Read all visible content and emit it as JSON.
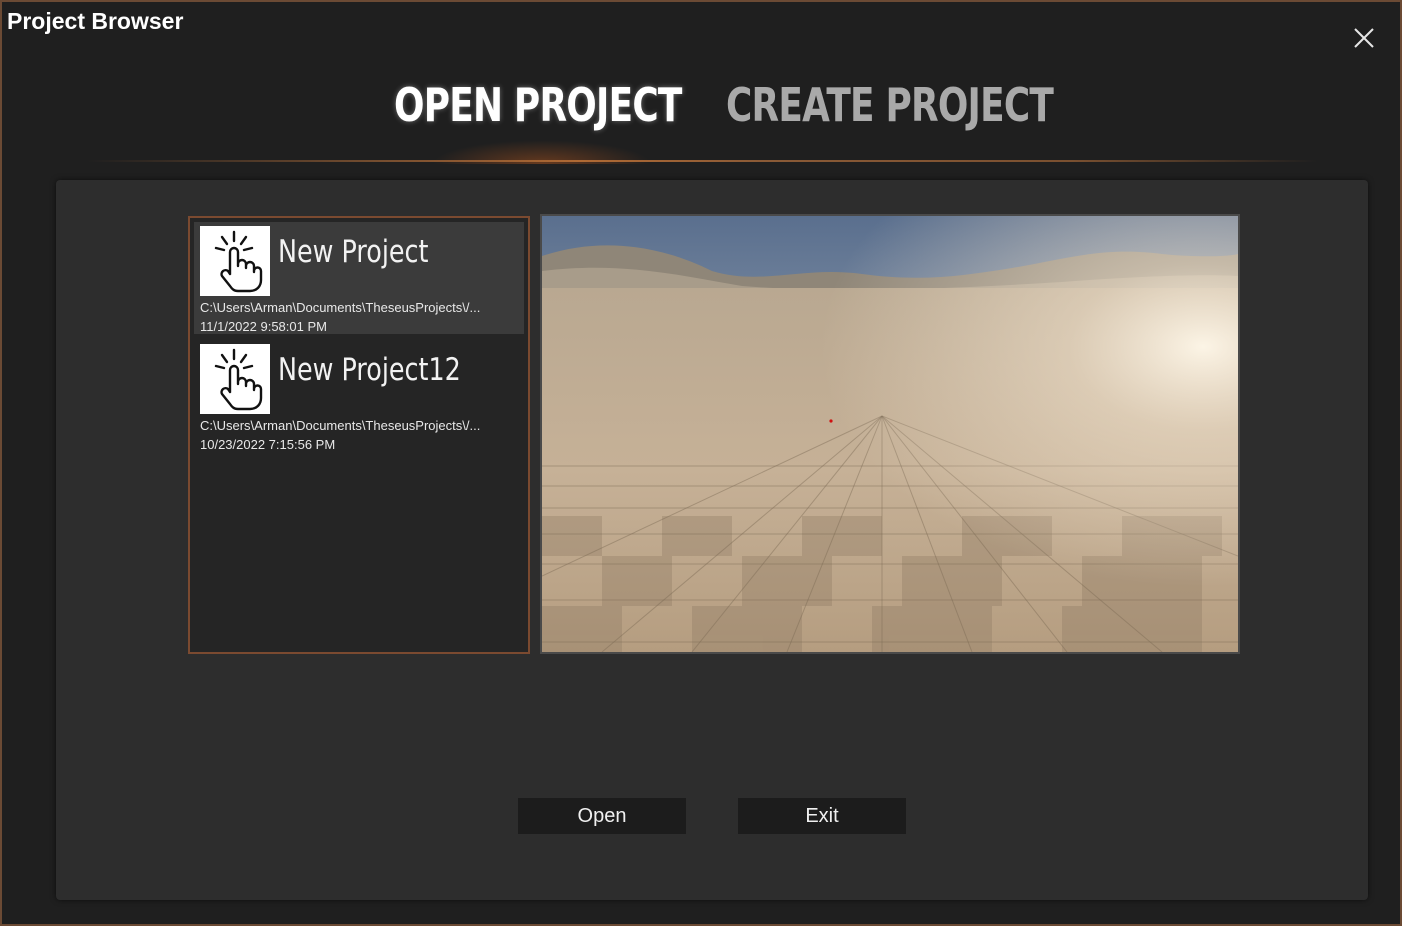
{
  "window": {
    "title": "Project Browser"
  },
  "tabs": [
    {
      "label": "OPEN PROJECT",
      "active": true
    },
    {
      "label": "CREATE PROJECT",
      "active": false
    }
  ],
  "projects": [
    {
      "name": "New Project",
      "path": "C:\\Users\\Arman\\Documents\\TheseusProjects\\/...",
      "date": "11/1/2022 9:58:01 PM",
      "selected": true,
      "icon": "tap-hand-icon"
    },
    {
      "name": "New Project12",
      "path": "C:\\Users\\Arman\\Documents\\TheseusProjects\\/...",
      "date": "10/23/2022 7:15:56 PM",
      "selected": false,
      "icon": "tap-hand-icon"
    }
  ],
  "buttons": {
    "open": "Open",
    "exit": "Exit"
  },
  "colors": {
    "accent": "#b06a34",
    "border": "#7b4a30",
    "background": "#1f1f1f",
    "panel": "#2d2d2d"
  }
}
